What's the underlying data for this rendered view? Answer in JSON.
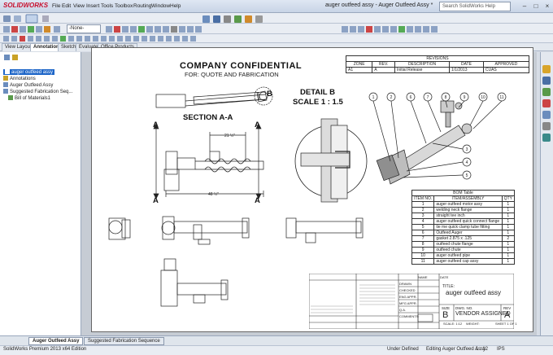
{
  "app": {
    "logo": "SOLIDWORKS",
    "document_title": "auger outfeed assy - Auger Outfeed Assy *",
    "search_placeholder": "Search SolidWorks Help"
  },
  "menu": [
    "File",
    "Edit",
    "View",
    "Insert",
    "Tools",
    "Toolbox",
    "Routing",
    "Window",
    "Help"
  ],
  "toolbar": {
    "layer_value": "-None-"
  },
  "command_tabs": [
    "View Layout",
    "Annotation",
    "Sketch",
    "Evaluate",
    "Office Products"
  ],
  "active_tab": "Annotation",
  "tree": {
    "items": [
      {
        "label": "auger outfeed assy",
        "selected": true
      },
      {
        "label": "Annotations"
      },
      {
        "label": "Auger Outfeed Assy"
      },
      {
        "label": "Suggested Fabrication Seq..."
      },
      {
        "label": "Bill of Materials1"
      }
    ]
  },
  "drawing": {
    "title": "COMPANY CONFIDENTIAL",
    "subtitle": "FOR: QUOTE AND FABRICATION",
    "section_label": "SECTION A-A",
    "detail_label": "DETAIL B",
    "detail_scale": "SCALE 1 : 1.5",
    "callout_b": "B",
    "section_marker": "A",
    "dim_upper": "21 ½\"",
    "dim_lower": "48 ½\"",
    "balloons": [
      "1",
      "2",
      "6",
      "7",
      "8",
      "9",
      "10",
      "11",
      "3",
      "4",
      "5"
    ],
    "revision": {
      "title": "REVISIONS",
      "headers": [
        "ZONE",
        "REV.",
        "DESCRIPTION",
        "DATE",
        "APPROVED"
      ],
      "row": [
        "A1",
        "A",
        "Initial Release",
        "1/1/2013",
        "CUAS"
      ]
    },
    "bom": {
      "title": "BOM Table",
      "headers": [
        "ITEM NO.",
        "ITEM/ASSEMBLY",
        "QTY"
      ],
      "rows": [
        [
          "1",
          "auger outfeed motor assy",
          "1"
        ],
        [
          "2",
          "welding neck flange",
          "1"
        ],
        [
          "3",
          "straight tee inch",
          "1"
        ],
        [
          "4",
          "auger outfeed quick connect flange",
          "1"
        ],
        [
          "5",
          "tie me quick clamp tube fitting",
          "1"
        ],
        [
          "6",
          "Outfeed Auger",
          "1"
        ],
        [
          "7",
          "gasket 2.875 x .125",
          "2"
        ],
        [
          "8",
          "outfeed chute flange",
          "1"
        ],
        [
          "9",
          "outfeed chute",
          "1"
        ],
        [
          "10",
          "auger outfeed pipe",
          "1"
        ],
        [
          "11",
          "auger outfeed cap assy",
          "1"
        ]
      ]
    },
    "titleblock": {
      "title_label": "TITLE:",
      "title": "auger outfeed assy",
      "size_label": "SIZE",
      "size": "B",
      "dwg_label": "DWG. NO.",
      "dwg_no": "VENDOR ASSIGNED",
      "rev_label": "REV",
      "rev": "A",
      "scale": "SCALE: 1:12",
      "weight": "WEIGHT:",
      "sheet": "SHEET 1 OF 1",
      "name": "NAME",
      "date": "DATE",
      "drawn": "DRAWN",
      "checked": "CHECKED",
      "eng_appr": "ENG APPR.",
      "mfg_appr": "MFG APPR.",
      "qa": "Q.A.",
      "comments": "COMMENTS:"
    }
  },
  "sheet_tabs": [
    "Auger Outfeed Assy",
    "Suggested Fabrication Sequence"
  ],
  "status": {
    "edition": "SolidWorks Premium 2013 x64 Edition",
    "defined": "Under Defined",
    "editing": "Editing Auger Outfeed Assy",
    "scale": "1 : 12",
    "units": "IPS"
  },
  "colors": {
    "logo": "#c8102e",
    "selection": "#1e66c8",
    "sheet_bg": "#ffffff",
    "canvas_bg": "#c6ccd4"
  }
}
